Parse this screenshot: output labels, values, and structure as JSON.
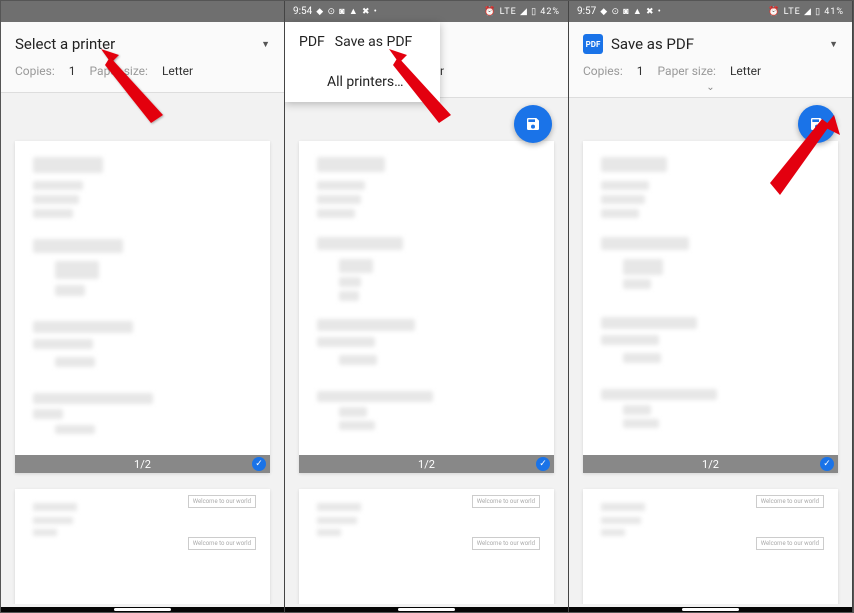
{
  "screens": [
    {
      "status": {
        "show": false
      },
      "printer_label": "Select a printer",
      "copies_label": "Copies:",
      "copies_value": "1",
      "papersize_label": "Paper size:",
      "papersize_value": "Letter",
      "page_counter": "1/2",
      "has_pdf_icon": false,
      "has_fab": false,
      "has_dropdown": false
    },
    {
      "status": {
        "show": true,
        "time": "9:54",
        "icons": "◆ ⊙ ◙ ▲ ✖ •",
        "right": "⏰ LTE ◢ ▯ 42%"
      },
      "printer_label": "Save as PDF",
      "dropdown_items": [
        "Save as PDF",
        "All printers…"
      ],
      "copies_label": "",
      "copies_value": "",
      "papersize_label": "",
      "papersize_value": "Letter",
      "page_counter": "1/2",
      "has_pdf_icon": true,
      "has_fab": true,
      "has_dropdown": true
    },
    {
      "status": {
        "show": true,
        "time": "9:57",
        "icons": "◆ ⊙ ◙ ▲ ✖ •",
        "right": "⏰ LTE ◢ ▯ 41%"
      },
      "printer_label": "Save as PDF",
      "copies_label": "Copies:",
      "copies_value": "1",
      "papersize_label": "Paper size:",
      "papersize_value": "Letter",
      "page_counter": "1/2",
      "has_pdf_icon": true,
      "has_fab": true,
      "has_dropdown": false
    }
  ],
  "pdf_icon_text": "PDF"
}
